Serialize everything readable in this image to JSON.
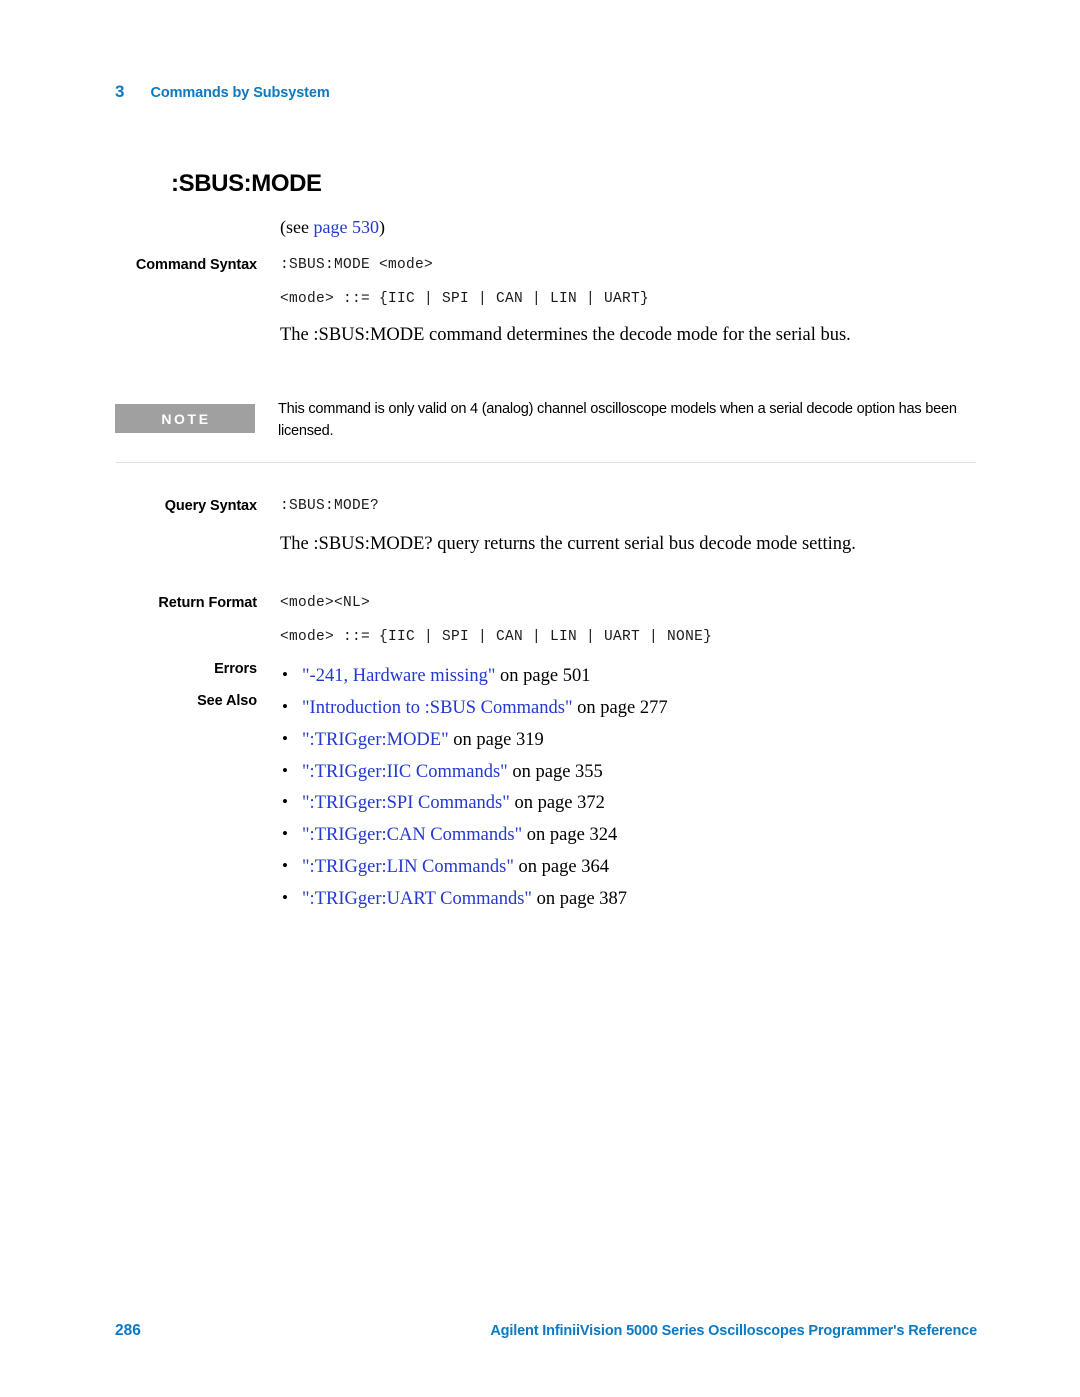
{
  "header": {
    "chapter_number": "3",
    "chapter_title": "Commands by Subsystem"
  },
  "command": {
    "title": ":SBUS:MODE",
    "see_reference": {
      "prefix": "(see ",
      "link": "page 530",
      "suffix": ")"
    }
  },
  "sections": {
    "command_syntax": {
      "label": "Command Syntax",
      "syntax": ":SBUS:MODE <mode>",
      "definition": "<mode> ::= {IIC | SPI | CAN | LIN | UART}",
      "description": "The :SBUS:MODE command determines the decode mode for the serial bus."
    },
    "note": {
      "badge": "NOTE",
      "text": "This command is only valid on 4 (analog) channel oscilloscope models when a serial decode option has been licensed."
    },
    "query_syntax": {
      "label": "Query Syntax",
      "syntax": ":SBUS:MODE?",
      "description": "The :SBUS:MODE? query returns the current serial bus decode mode setting."
    },
    "return_format": {
      "label": "Return Format",
      "syntax": "<mode><NL>",
      "definition": "<mode> ::= {IIC | SPI | CAN | LIN | UART | NONE}"
    },
    "errors": {
      "label": "Errors",
      "items": [
        {
          "link": "\"-241, Hardware missing\"",
          "suffix": " on page 501"
        }
      ]
    },
    "see_also": {
      "label": "See Also",
      "items": [
        {
          "link": "\"Introduction to :SBUS Commands\"",
          "suffix": " on page 277"
        },
        {
          "link": "\":TRIGger:MODE\"",
          "suffix": " on page 319"
        },
        {
          "link": "\":TRIGger:IIC Commands\"",
          "suffix": " on page 355"
        },
        {
          "link": "\":TRIGger:SPI Commands\"",
          "suffix": " on page 372"
        },
        {
          "link": "\":TRIGger:CAN Commands\"",
          "suffix": " on page 324"
        },
        {
          "link": "\":TRIGger:LIN Commands\"",
          "suffix": " on page 364"
        },
        {
          "link": "\":TRIGger:UART Commands\"",
          "suffix": " on page 387"
        }
      ]
    }
  },
  "footer": {
    "page_number": "286",
    "title": "Agilent InfiniiVision 5000 Series Oscilloscopes Programmer's Reference"
  },
  "colors": {
    "accent_blue": "#0c79c0",
    "link_blue": "#2338cf",
    "note_gray": "#a0a0a0"
  }
}
